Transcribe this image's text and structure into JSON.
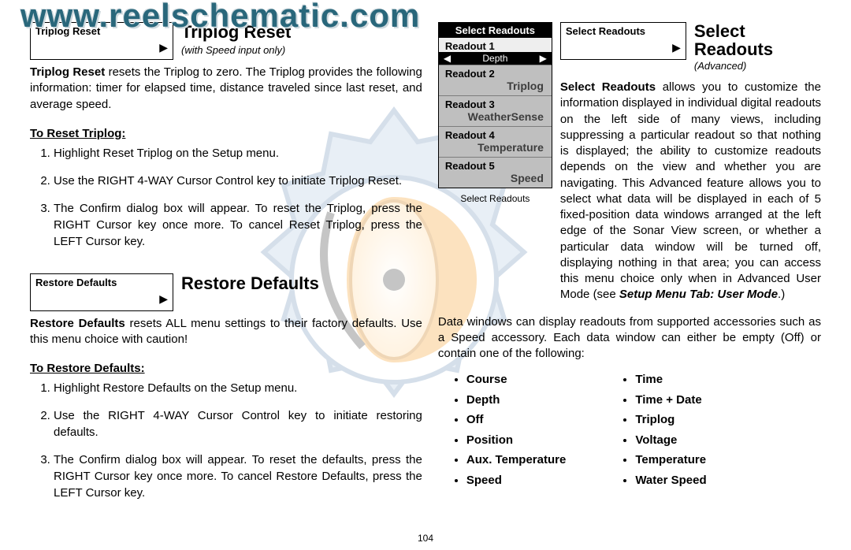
{
  "watermark": {
    "url_text": "www.reelschematic.com"
  },
  "col_left": {
    "triplog": {
      "menu_box_title": "Triplog Reset",
      "section_title": "Triplog Reset",
      "section_sub": "(with Speed input only)",
      "desc_lead": "Triplog Reset",
      "desc_rest": " resets the Triplog to zero. The Triplog provides the following information: timer for elapsed time, distance traveled since last reset, and average speed.",
      "instr_head": "To Reset Triplog:",
      "steps": [
        "Highlight Reset Triplog on the Setup menu.",
        "Use the RIGHT 4-WAY Cursor Control key to initiate Triplog Reset.",
        "The Confirm dialog box will appear. To reset the Triplog, press the RIGHT Cursor key once more. To cancel Reset Triplog, press the LEFT Cursor key."
      ]
    },
    "restore": {
      "menu_box_title": "Restore Defaults",
      "section_title": "Restore Defaults",
      "desc_lead": "Restore Defaults",
      "desc_rest": " resets ALL menu settings to their factory defaults. Use this menu choice with caution!",
      "instr_head": "To Restore Defaults:",
      "steps": [
        "Highlight Restore Defaults on the Setup menu.",
        "Use the RIGHT 4-WAY Cursor Control key to initiate restoring defaults.",
        "The Confirm dialog box will appear. To reset the defaults, press the RIGHT Cursor key once more. To cancel Restore Defaults, press the LEFT Cursor key."
      ]
    }
  },
  "col_right": {
    "readouts_panel": {
      "header": "Select Readouts",
      "items": [
        {
          "label": "Readout 1",
          "value": "Depth"
        },
        {
          "label": "Readout 2",
          "value": "Triplog"
        },
        {
          "label": "Readout 3",
          "value": "WeatherSense"
        },
        {
          "label": "Readout 4",
          "value": "Temperature"
        },
        {
          "label": "Readout 5",
          "value": "Speed"
        }
      ],
      "caption": "Select Readouts"
    },
    "select": {
      "menu_box_title": "Select Readouts",
      "section_title_l1": "Select",
      "section_title_l2": "Readouts",
      "section_sub": "(Advanced)",
      "desc_lead": "Select Readouts",
      "desc_rest": " allows you to customize the information displayed in individual digital readouts on the left side of many views, including suppressing a particular readout so that nothing is displayed; the ability to customize readouts depends on the view and whether you are navigating. This Advanced feature allows you to select what data will be displayed in each of 5 fixed-position data windows arranged at the left edge of the Sonar View screen, or whether a particular data window will be turned off, displaying nothing in that area; you can access this menu choice only when in Advanced User Mode (see ",
      "desc_tail_bold": "Setup Menu Tab: User Mode",
      "desc_tail_end": ".)"
    },
    "datawin_intro": "Data windows can display readouts from supported accessories such as a Speed accessory. Each data window can either be empty (Off) or contain one of the following:",
    "datawin_left": [
      "Course",
      "Depth",
      "Off",
      "Position",
      "Aux. Temperature",
      "Speed"
    ],
    "datawin_right": [
      "Time",
      "Time + Date",
      "Triplog",
      "Voltage",
      "Temperature",
      "Water Speed"
    ]
  },
  "page_number": "104"
}
